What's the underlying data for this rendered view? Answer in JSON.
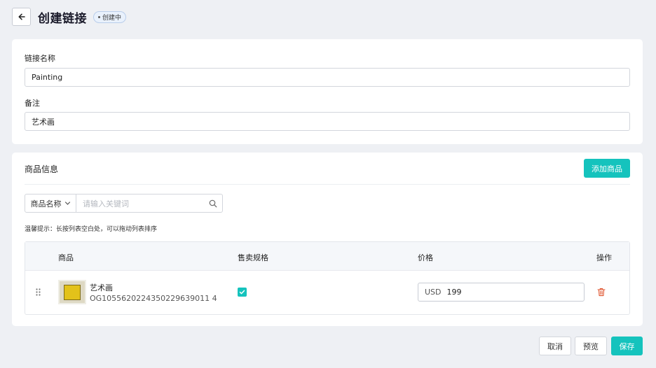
{
  "header": {
    "title": "创建链接",
    "status": "创建中"
  },
  "basic": {
    "name_label": "链接名称",
    "name_value": "Painting",
    "remark_label": "备注",
    "remark_value": "艺术画"
  },
  "goods": {
    "section_title": "商品信息",
    "add_button": "添加商品",
    "filter_select": "商品名称",
    "filter_placeholder": "请输入关键词",
    "tip": "温馨提示：长按列表空白处，可以拖动列表排序",
    "columns": {
      "product": "商品",
      "spec": "售卖规格",
      "price": "价格",
      "action": "操作"
    },
    "rows": [
      {
        "name": "艺术画",
        "code": "OG1055620224350229639011 4",
        "spec_checked": true,
        "currency": "USD",
        "price": "199"
      }
    ]
  },
  "footer": {
    "cancel": "取消",
    "preview": "预览",
    "save": "保存"
  },
  "colors": {
    "accent": "#15c3bd",
    "danger": "#e0552f",
    "background": "#eef0f4"
  },
  "icons": [
    "arrow-left-icon",
    "chevron-down-icon",
    "search-icon",
    "drag-handle-icon",
    "check-icon",
    "trash-icon"
  ]
}
